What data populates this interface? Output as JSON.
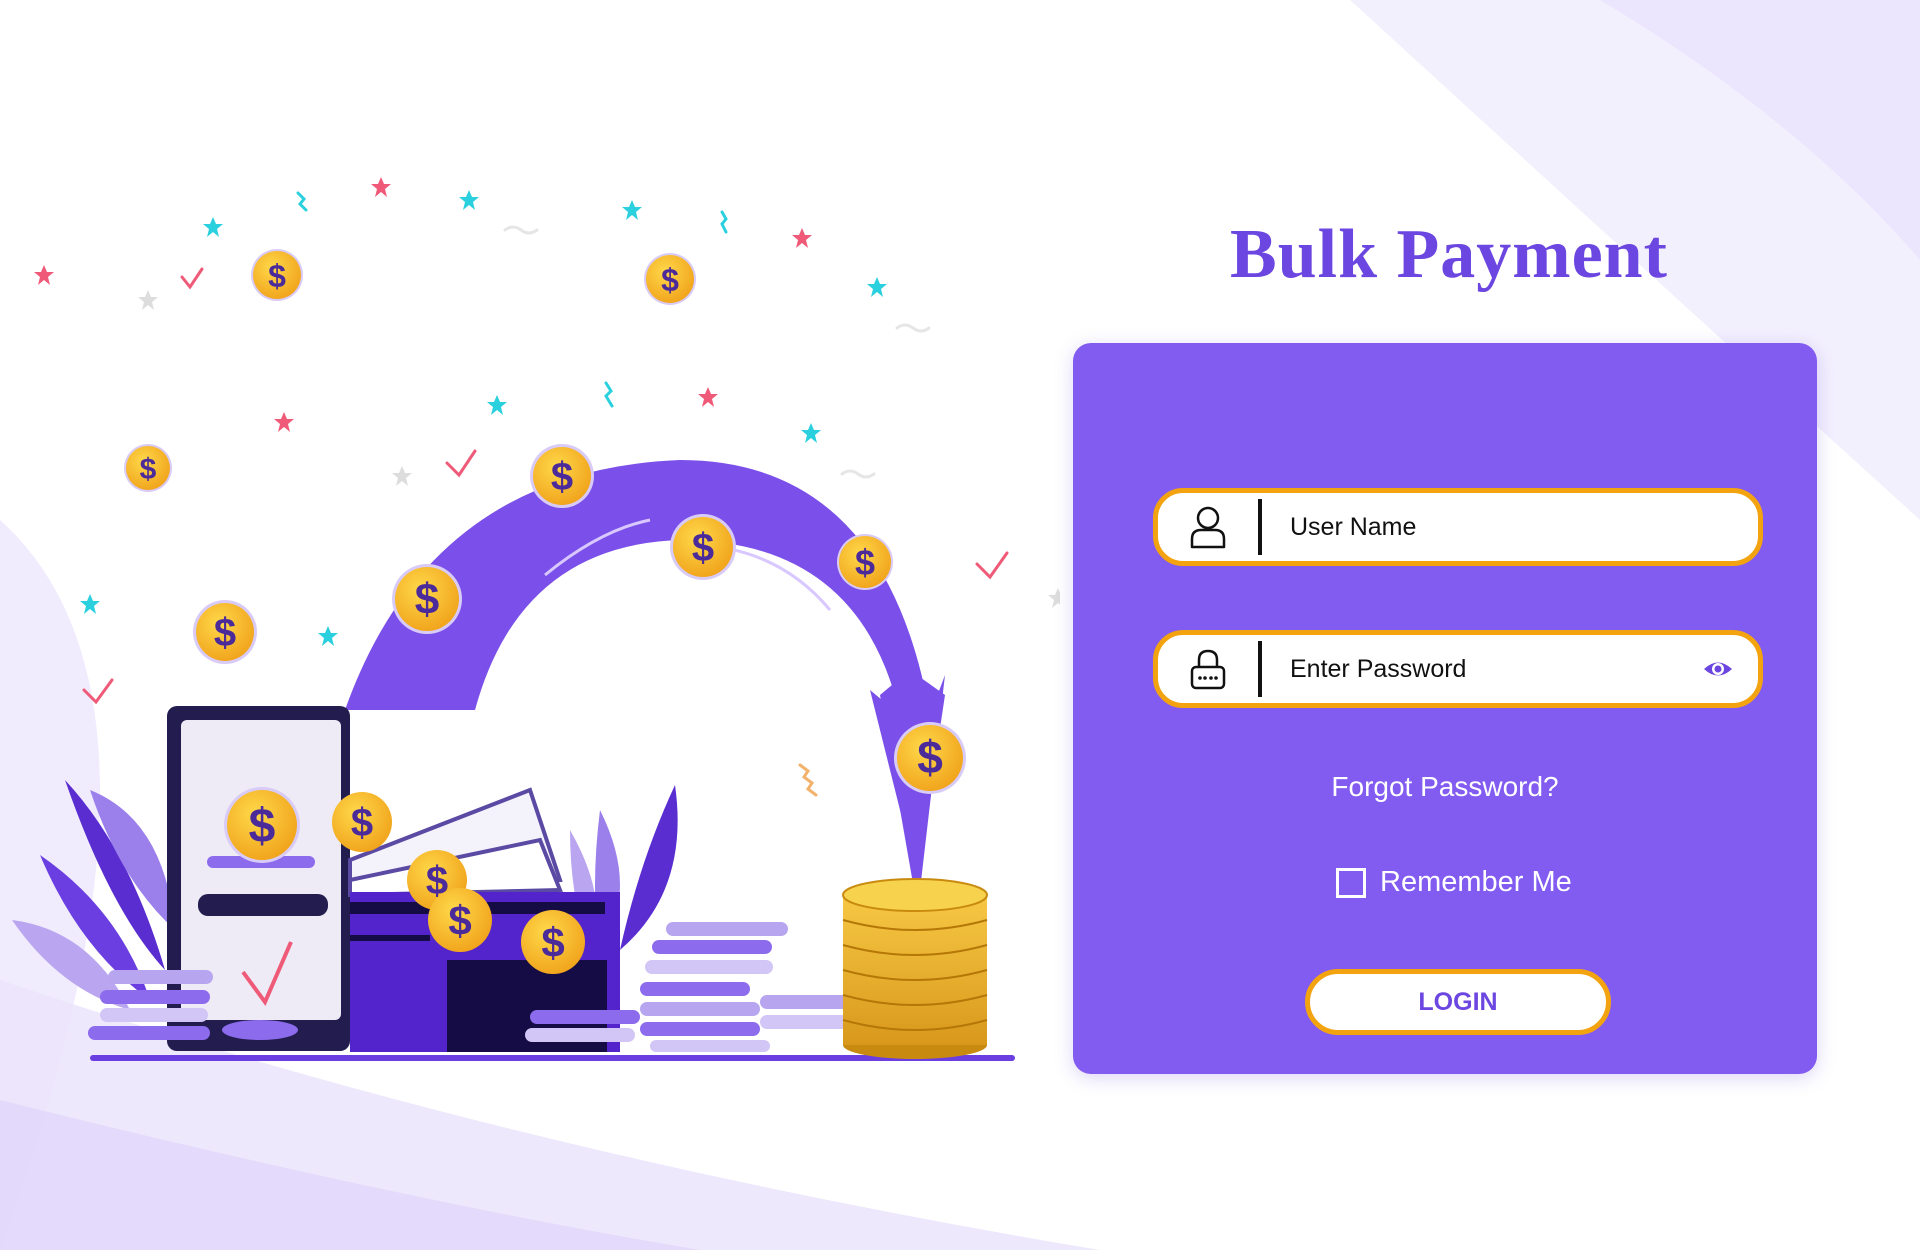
{
  "app": {
    "title": "Bulk Payment"
  },
  "login": {
    "username_placeholder": "User Name",
    "password_placeholder": "Enter Password",
    "forgot_password": "Forgot Password?",
    "remember_me": "Remember Me",
    "remember_checked": false,
    "login_button": "LOGIN"
  },
  "icons": {
    "user": "user-icon",
    "lock": "lock-icon",
    "eye": "eye-icon",
    "coin_symbol": "$"
  },
  "colors": {
    "accent": "#825bf1",
    "title": "#6c46e0",
    "border": "#f2a30f",
    "coin": "#f7b928",
    "star_pink": "#ee5a78",
    "star_cyan": "#2ad0de"
  }
}
